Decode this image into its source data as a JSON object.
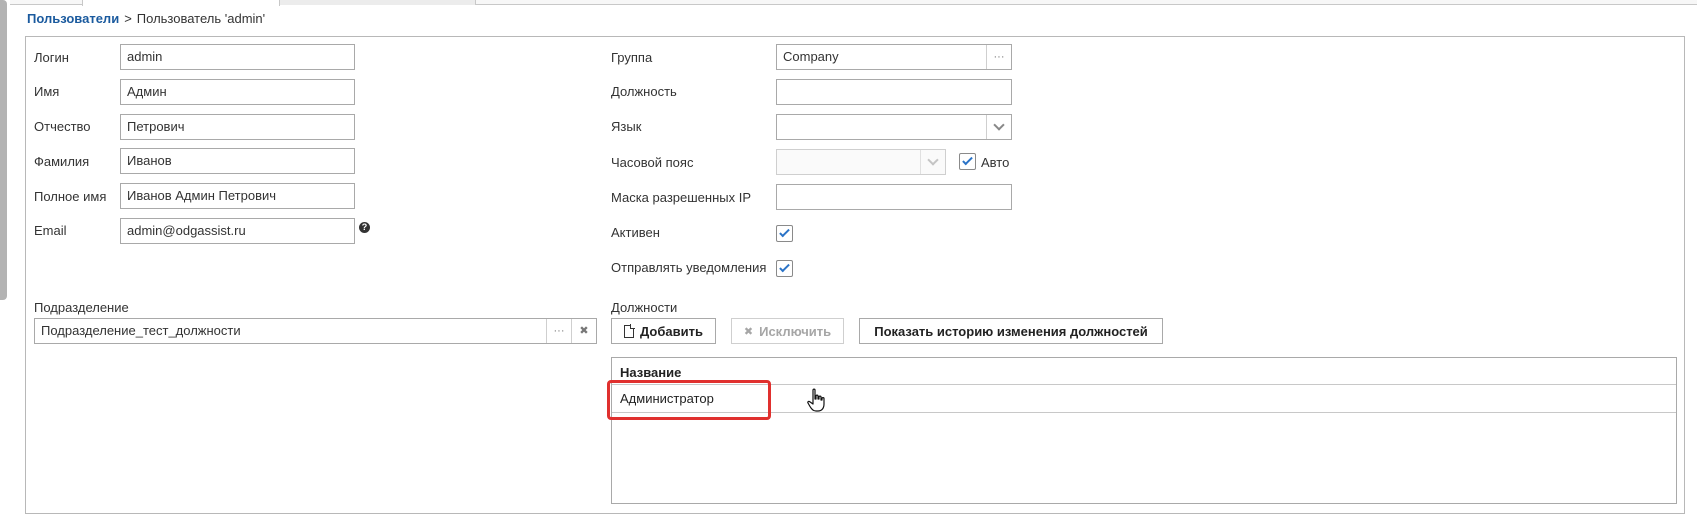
{
  "breadcrumb": {
    "parent": "Пользователи",
    "separator": ">",
    "current": "Пользователь 'admin'"
  },
  "left_fields": {
    "login": {
      "label": "Логин",
      "value": "admin"
    },
    "first_name": {
      "label": "Имя",
      "value": "Админ"
    },
    "patronymic": {
      "label": "Отчество",
      "value": "Петрович"
    },
    "last_name": {
      "label": "Фамилия",
      "value": "Иванов"
    },
    "full_name": {
      "label": "Полное имя",
      "value": "Иванов Админ Петрович"
    },
    "email": {
      "label": "Email",
      "value": "admin@odgassist.ru",
      "help_icon": "?"
    }
  },
  "right_fields": {
    "group": {
      "label": "Группа",
      "value": "Company",
      "picker_icon": "···"
    },
    "position": {
      "label": "Должность",
      "value": ""
    },
    "language": {
      "label": "Язык",
      "value": ""
    },
    "timezone": {
      "label": "Часовой пояс",
      "value": "",
      "auto_label": "Авто",
      "auto_checked": true
    },
    "ip_mask": {
      "label": "Маска разрешенных IP",
      "value": ""
    },
    "active": {
      "label": "Активен",
      "checked": true
    },
    "notifications": {
      "label": "Отправлять уведомления",
      "checked": true
    }
  },
  "department": {
    "label": "Подразделение",
    "value": "Подразделение_тест_должности",
    "picker_icon": "···",
    "clear_icon": "✖"
  },
  "positions": {
    "label": "Должности",
    "add_label": "Добавить",
    "exclude_label": "Исключить",
    "history_label": "Показать историю изменения должностей",
    "exclude_icon": "✖",
    "table": {
      "column_header": "Название",
      "rows": [
        "Администратор"
      ]
    }
  },
  "colors": {
    "link": "#1a5a9e",
    "check": "#2a73c7",
    "highlight": "#e0302e"
  }
}
